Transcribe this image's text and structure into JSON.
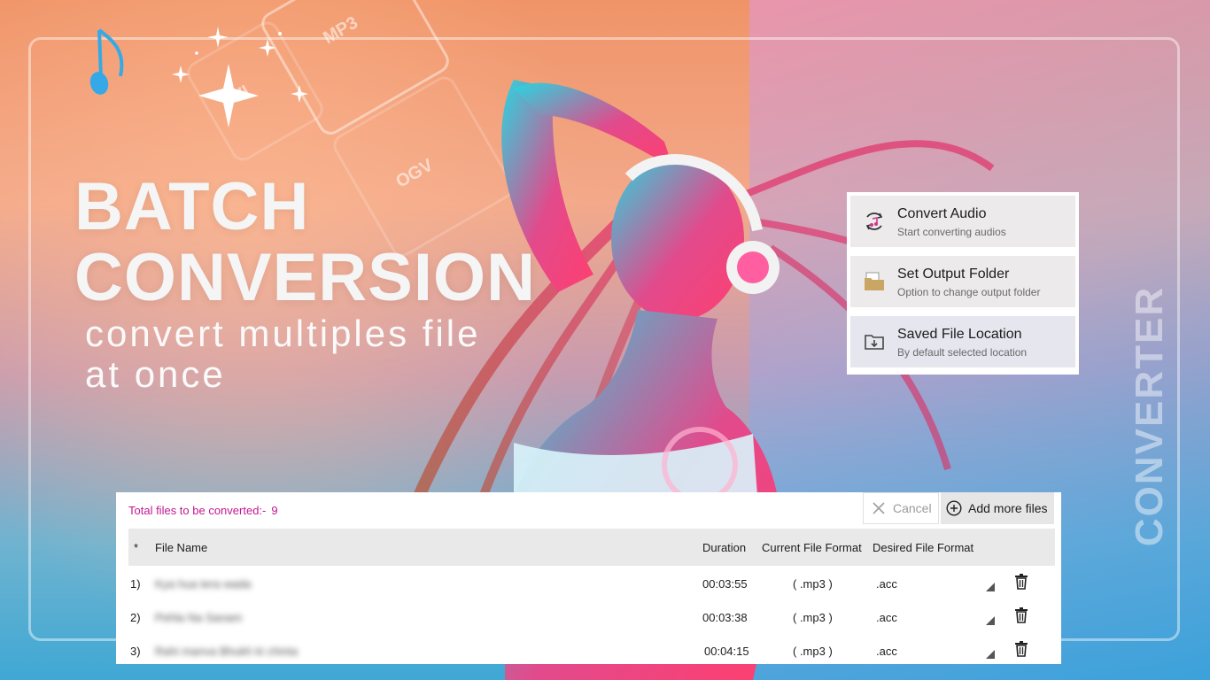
{
  "hero": {
    "line1": "BATCH",
    "line2": "CONVERSION",
    "sub1": "convert multiples file",
    "sub2": "at once",
    "side_word": "CONVERTER"
  },
  "format_tiles": [
    "MP3",
    "OGV",
    "VI"
  ],
  "menu": {
    "items": [
      {
        "title": "Convert Audio",
        "desc": "Start converting audios",
        "icon": "convert-audio-icon"
      },
      {
        "title": "Set Output Folder",
        "desc": "Option to change output folder",
        "icon": "folder-icon"
      },
      {
        "title": "Saved File Location",
        "desc": "By default selected location",
        "icon": "download-folder-icon"
      }
    ]
  },
  "file_panel": {
    "total_label": "Total files to be converted:-",
    "total_count": "9",
    "cancel_label": "Cancel",
    "add_label": "Add more files",
    "columns": {
      "index": "*",
      "name": "File Name",
      "duration": "Duration",
      "current": "Current File Format",
      "desired": "Desired File Format"
    },
    "rows": [
      {
        "index": "1)",
        "name": "Kya hua tera wada",
        "duration": "00:03:55",
        "current": "( .mp3 )",
        "desired": ".acc"
      },
      {
        "index": "2)",
        "name": "Pehla Na Sanam",
        "duration": "00:03:38",
        "current": "( .mp3 )",
        "desired": ".acc"
      },
      {
        "index": "3)",
        "name": "Rahi manva Bhukh ki chinta",
        "duration": "00:04:15",
        "current": "( .mp3 )",
        "desired": ".acc"
      }
    ]
  },
  "colors": {
    "accent_magenta": "#c2188f",
    "note_blue": "#35a9e8"
  }
}
